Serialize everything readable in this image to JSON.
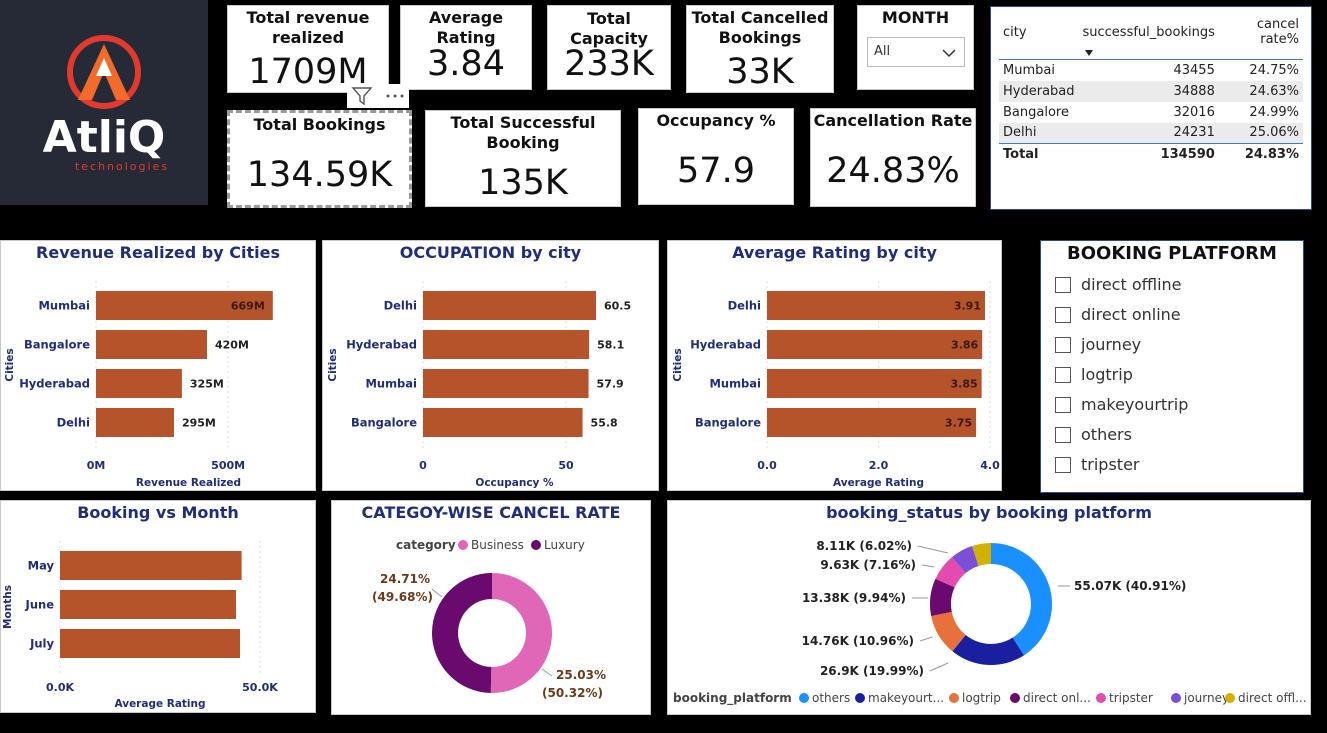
{
  "kpis": {
    "total_revenue": {
      "title": "Total revenue realized",
      "title_l1": "Total revenue",
      "title_l2": "realized",
      "value": "1709M"
    },
    "avg_rating": {
      "title": "Average Rating",
      "value": "3.84"
    },
    "total_capacity": {
      "title": "Total Capacity",
      "value": "233K"
    },
    "total_cancelled": {
      "title_l1": "Total Cancelled",
      "title_l2": "Bookings",
      "value": "33K"
    },
    "total_bookings": {
      "title": "Total Bookings",
      "value": "134.59K"
    },
    "total_successful": {
      "title_l1": "Total Successful",
      "title_l2": "Booking",
      "value": "135K"
    },
    "occupancy": {
      "title": "Occupancy %",
      "value": "57.9"
    },
    "cancellation_rate": {
      "title": "Cancellation Rate",
      "value": "24.83%"
    }
  },
  "logo": {
    "brand": "AtliQ",
    "sub": "technologies"
  },
  "month_slicer": {
    "title": "MONTH",
    "selected": "All"
  },
  "city_table": {
    "headers": [
      "city",
      "successful_bookings",
      "cancel rate%"
    ],
    "rows": [
      [
        "Mumbai",
        "43455",
        "24.75%"
      ],
      [
        "Hyderabad",
        "34888",
        "24.63%"
      ],
      [
        "Bangalore",
        "32016",
        "24.99%"
      ],
      [
        "Delhi",
        "24231",
        "25.06%"
      ]
    ],
    "total": [
      "Total",
      "134590",
      "24.83%"
    ]
  },
  "platform_slicer": {
    "title": "BOOKING PLATFORM",
    "items": [
      "direct offline",
      "direct online",
      "journey",
      "logtrip",
      "makeyourtrip",
      "others",
      "tripster"
    ]
  },
  "colors": {
    "bar": "#b5532b",
    "title": "#1f2d7a",
    "business": "#e066b8",
    "luxury": "#6b0a6e"
  },
  "chart_data": [
    {
      "id": "revenue",
      "type": "bar",
      "title": "Revenue Realized by Cities",
      "categories": [
        "Mumbai",
        "Bangalore",
        "Hyderabad",
        "Delhi"
      ],
      "values": [
        669,
        420,
        325,
        295
      ],
      "labels": [
        "669M",
        "420M",
        "325M",
        "295M"
      ],
      "xlabel": "Revenue Realized",
      "ylabel": "Cities",
      "xlim": [
        0,
        700
      ],
      "ticks": [
        0,
        500
      ],
      "tick_labels": [
        "0M",
        "500M"
      ]
    },
    {
      "id": "occupation",
      "type": "bar",
      "title": "OCCUPATION by city",
      "categories": [
        "Delhi",
        "Hyderabad",
        "Mumbai",
        "Bangalore"
      ],
      "values": [
        60.5,
        58.1,
        57.9,
        55.8
      ],
      "labels": [
        "60.5",
        "58.1",
        "57.9",
        "55.8"
      ],
      "xlabel": "Occupancy %",
      "ylabel": "Cities",
      "xlim": [
        0,
        64
      ],
      "ticks": [
        0,
        50
      ],
      "tick_labels": [
        "0",
        "50"
      ]
    },
    {
      "id": "rating",
      "type": "bar",
      "title": "Average Rating by city",
      "categories": [
        "Delhi",
        "Hyderabad",
        "Mumbai",
        "Bangalore"
      ],
      "values": [
        3.91,
        3.86,
        3.85,
        3.75
      ],
      "labels": [
        "3.91",
        "3.86",
        "3.85",
        "3.75"
      ],
      "xlabel": "Average Rating",
      "ylabel": "Cities",
      "xlim": [
        0,
        4.0
      ],
      "ticks": [
        0,
        2,
        4
      ],
      "tick_labels": [
        "0.0",
        "2.0",
        "4.0"
      ]
    },
    {
      "id": "month",
      "type": "bar",
      "title": "Booking vs Month",
      "categories": [
        "May",
        "June",
        "July"
      ],
      "values": [
        45.4,
        44.0,
        45.0
      ],
      "labels": [],
      "xlabel": "Average Rating",
      "ylabel": "Months",
      "xlim": [
        0,
        50
      ],
      "ticks": [
        0,
        50
      ],
      "tick_labels": [
        "0.0K",
        "50.0K"
      ]
    },
    {
      "id": "category",
      "type": "pie",
      "title": "CATEGOY-WISE CANCEL RATE",
      "legend_title": "category",
      "slices": [
        {
          "name": "Business",
          "value": 50.32,
          "label_l1": "25.03%",
          "label_l2": "(50.32%)",
          "color": "#e066b8"
        },
        {
          "name": "Luxury",
          "value": 49.68,
          "label_l1": "24.71%",
          "label_l2": "(49.68%)",
          "color": "#6b0a6e"
        }
      ]
    },
    {
      "id": "platform",
      "type": "pie",
      "title": "booking_status by booking platform",
      "legend_title": "booking_platform",
      "slices": [
        {
          "name": "others",
          "value": 40.91,
          "label": "55.07K (40.91%)",
          "color": "#1a8fff"
        },
        {
          "name": "makeyourt...",
          "value": 19.99,
          "label": "26.9K (19.99%)",
          "color": "#1a1fa0"
        },
        {
          "name": "logtrip",
          "value": 10.96,
          "label": "14.76K (10.96%)",
          "color": "#e8703a"
        },
        {
          "name": "direct onl...",
          "value": 9.94,
          "label": "13.38K (9.94%)",
          "color": "#6b0a6e"
        },
        {
          "name": "tripster",
          "value": 7.16,
          "label": "9.63K (7.16%)",
          "color": "#e44bb0"
        },
        {
          "name": "journey",
          "value": 6.02,
          "label": "8.11K (6.02%)",
          "color": "#7b4fd6"
        },
        {
          "name": "direct offl...",
          "value": 5.02,
          "label": "",
          "color": "#d4b000"
        }
      ]
    }
  ]
}
